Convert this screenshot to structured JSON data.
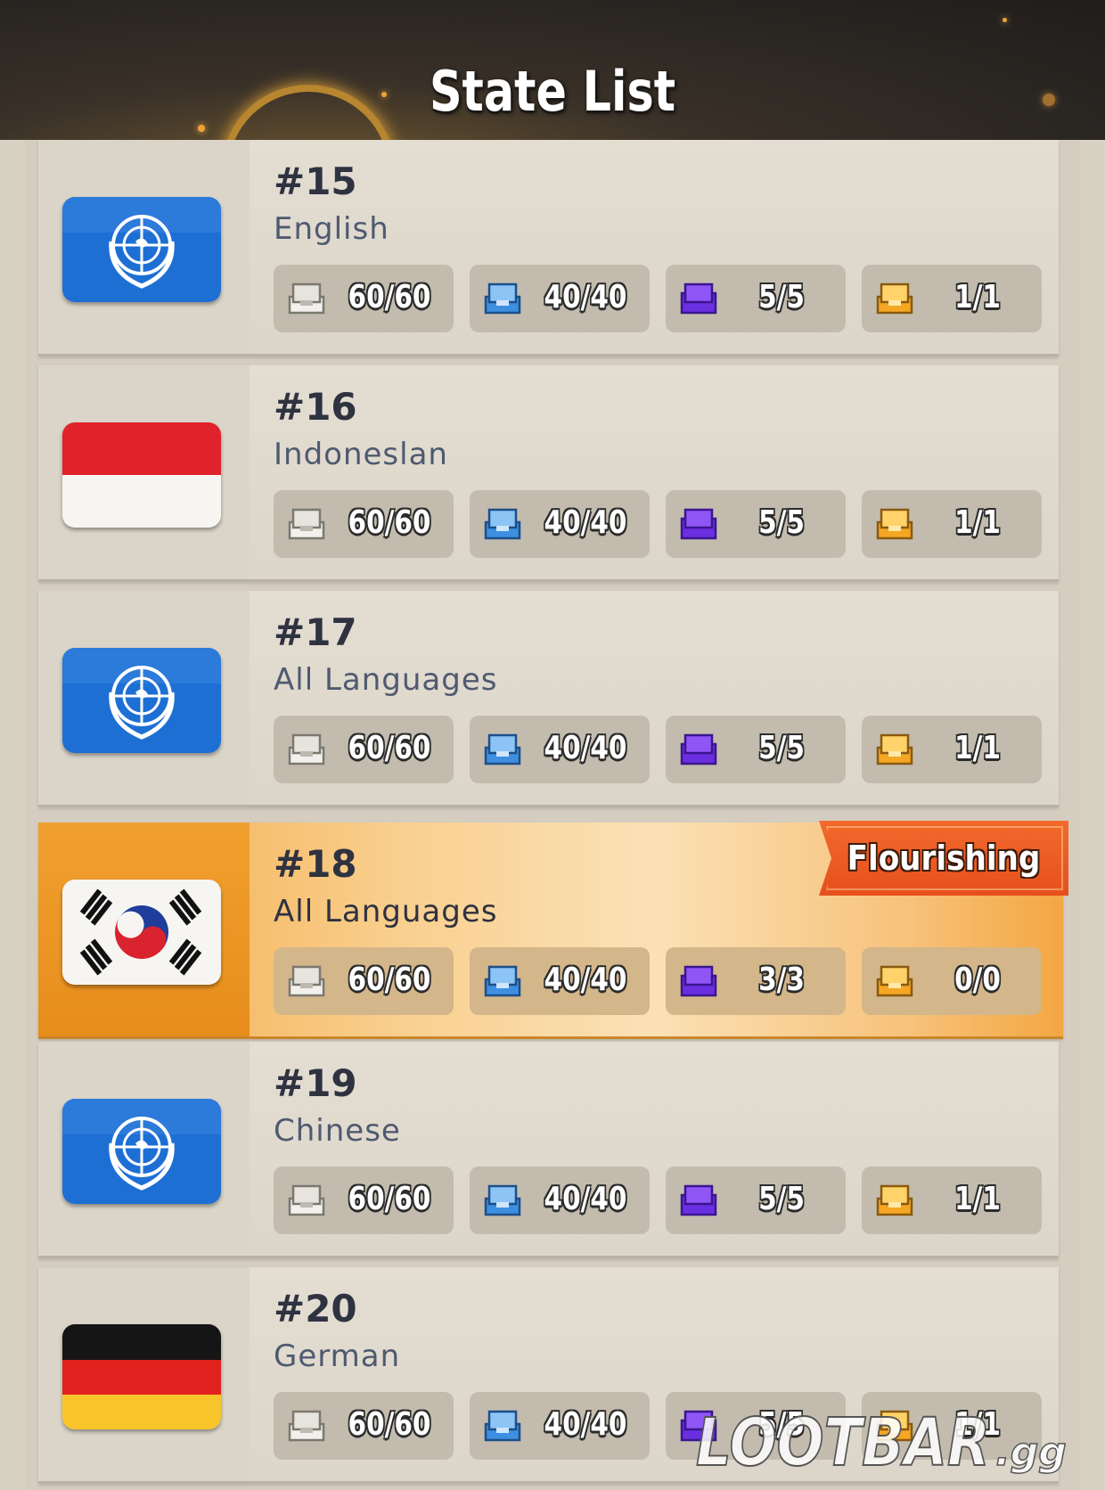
{
  "title": "State List",
  "states": [
    {
      "number": "#15",
      "language": "English",
      "flag": "un-flag",
      "stats": [
        "60/60",
        "40/40",
        "5/5",
        "1/1"
      ]
    },
    {
      "number": "#16",
      "language": "Indoneslan",
      "flag": "indonesia-flag",
      "stats": [
        "60/60",
        "40/40",
        "5/5",
        "1/1"
      ]
    },
    {
      "number": "#17",
      "language": "All Languages",
      "flag": "un-flag",
      "stats": [
        "60/60",
        "40/40",
        "5/5",
        "1/1"
      ]
    },
    {
      "number": "#18",
      "language": "All Languages",
      "flag": "south-korea-flag",
      "badge": "Flourishing",
      "stats": [
        "60/60",
        "40/40",
        "3/3",
        "0/0"
      ]
    },
    {
      "number": "#19",
      "language": "Chinese",
      "flag": "un-flag",
      "stats": [
        "60/60",
        "40/40",
        "5/5",
        "1/1"
      ]
    },
    {
      "number": "#20",
      "language": "German",
      "flag": "germany-flag",
      "stats": [
        "60/60",
        "40/40",
        "5/5",
        "1/1"
      ]
    }
  ],
  "stat_icons": [
    "white-chest-icon",
    "blue-chest-icon",
    "purple-chest-icon",
    "gold-chest-icon"
  ],
  "colors": {
    "highlight": "#f3a742",
    "badge": "#e64f1c",
    "un_blue": "#1e6fd4"
  },
  "watermark": "LOOTBAR.gg"
}
